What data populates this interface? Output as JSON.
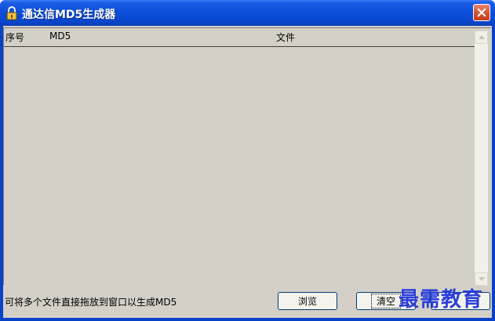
{
  "window": {
    "title": "通达信MD5生成器"
  },
  "list": {
    "columns": [
      "序号",
      "MD5",
      "文件"
    ],
    "rows": []
  },
  "status_text": "可将多个文件直接拖放到窗口以生成MD5",
  "buttons": {
    "browse": "浏览",
    "clear": "清空"
  },
  "watermark": "最需教育",
  "colors": {
    "titlebar": "#0a47d0",
    "client": "#d4d0c8",
    "close": "#d5502f",
    "watermark": "#2a3fd8"
  }
}
